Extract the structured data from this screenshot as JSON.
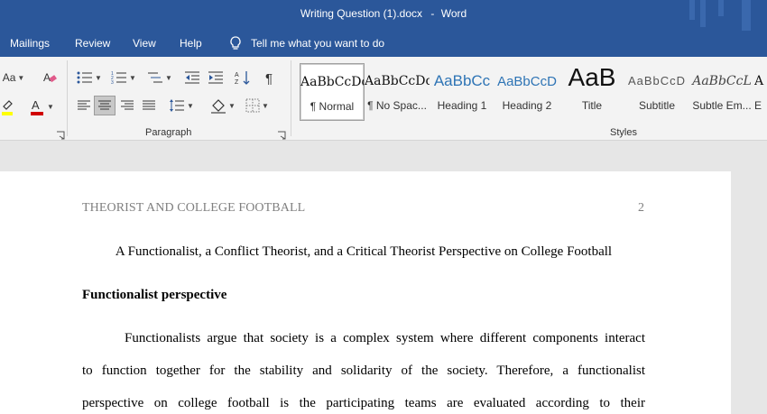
{
  "window": {
    "doc_name": "Writing Question (1).docx",
    "separator": "-",
    "app_name": "Word"
  },
  "menu": {
    "tabs": [
      {
        "label": "Mailings"
      },
      {
        "label": "Review"
      },
      {
        "label": "View"
      },
      {
        "label": "Help"
      }
    ],
    "tell_me": "Tell me what you want to do"
  },
  "ribbon": {
    "font_group": {
      "aa_label": "Aa"
    },
    "paragraph_group": {
      "label": "Paragraph"
    },
    "styles_group": {
      "label": "Styles",
      "styles": [
        {
          "sample": "AaBbCcDd",
          "name": "¶ Normal",
          "selected": true
        },
        {
          "sample": "AaBbCcDd",
          "name": "¶ No Spac..."
        },
        {
          "sample": "AaBbCc",
          "name": "Heading 1"
        },
        {
          "sample": "AaBbCcD",
          "name": "Heading 2"
        },
        {
          "sample": "AaB",
          "name": "Title"
        },
        {
          "sample": "AaBbCcD",
          "name": "Subtitle"
        },
        {
          "sample": "AaBbCcL",
          "name": "Subtle Em..."
        },
        {
          "sample": "A",
          "name": "E"
        }
      ]
    },
    "colors": {
      "highlight": "#ffff00",
      "font_color": "#d00000"
    }
  },
  "document": {
    "header": "THEORIST AND COLLEGE FOOTBALL",
    "page_number": "2",
    "title": "A Functionalist, a Conflict Theorist, and a Critical Theorist Perspective on College Football",
    "heading": "Functionalist perspective",
    "lines": [
      "Functionalists argue that society is a complex system where different components interact",
      "to function together for the stability and solidarity of the society. Therefore, a functionalist",
      "perspective on college football is the participating teams are evaluated according to their"
    ]
  },
  "theme": {
    "title_bar": "#2b579a"
  }
}
